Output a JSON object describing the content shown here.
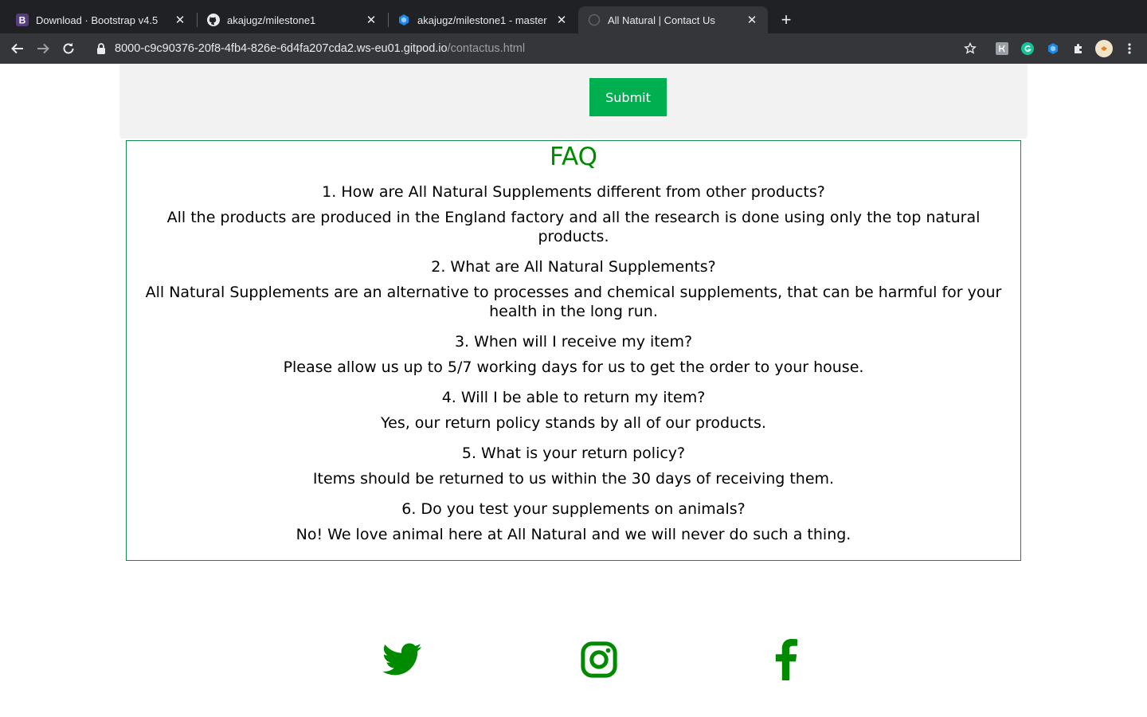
{
  "browser": {
    "tabs": [
      {
        "title": "Download · Bootstrap v4.5",
        "icon": "bootstrap-icon",
        "active": false
      },
      {
        "title": "akajugz/milestone1",
        "icon": "github-icon",
        "active": false
      },
      {
        "title": "akajugz/milestone1 - master",
        "icon": "gitpod-icon",
        "active": false
      },
      {
        "title": "All Natural | Contact Us",
        "icon": "globe-icon",
        "active": true
      }
    ],
    "new_tab_label": "+",
    "url_host": "8000-c9c90376-20f8-4fb4-826e-6d4fa207cda2.ws-eu01.gitpod.io",
    "url_path": "/contactus.html"
  },
  "form": {
    "submit_label": "Submit"
  },
  "faq": {
    "title": "FAQ",
    "items": [
      {
        "q": "1. How are All Natural Supplements different from other products?",
        "a": "All the products are produced in the England factory and all the research is done using only the top natural products."
      },
      {
        "q": "2. What are All Natural Supplements?",
        "a": "All Natural Supplements are an alternative to processes and chemical supplements, that can be harmful for your health in the long run."
      },
      {
        "q": "3. When will I receive my item?",
        "a": "Please allow us up to 5/7 working days for us to get the order to your house."
      },
      {
        "q": "4. Will I be able to return my item?",
        "a": "Yes, our return policy stands by all of our products."
      },
      {
        "q": "5. What is your return policy?",
        "a": "Items should be returned to us within the 30 days of receiving them."
      },
      {
        "q": "6. Do you test your supplements on animals?",
        "a": "No! We love animal here at All Natural and we will never do such a thing."
      }
    ]
  },
  "social": [
    {
      "name": "twitter",
      "icon": "twitter-icon"
    },
    {
      "name": "instagram",
      "icon": "instagram-icon"
    },
    {
      "name": "facebook",
      "icon": "facebook-icon"
    }
  ],
  "colors": {
    "accent_green": "#008a00",
    "button_green": "#00b050",
    "border_green": "#198754",
    "form_bg": "#f2f2f2"
  }
}
